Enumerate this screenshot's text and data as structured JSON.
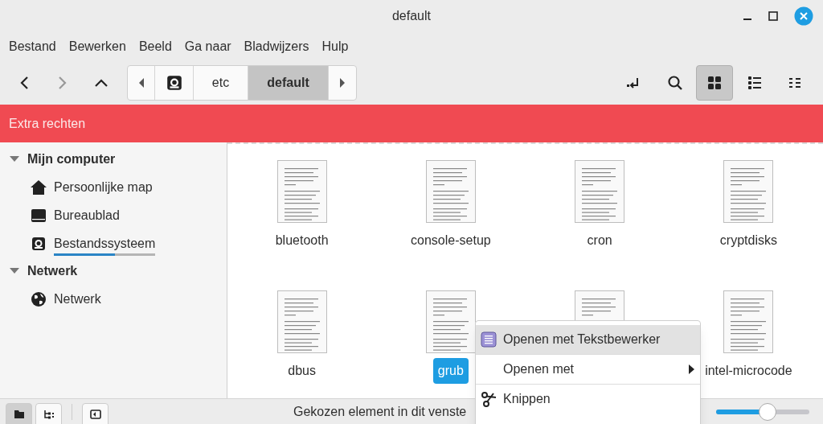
{
  "window": {
    "title": "default"
  },
  "menu": [
    "Bestand",
    "Bewerken",
    "Beeld",
    "Ga naar",
    "Bladwijzers",
    "Hulp"
  ],
  "nav": {
    "back_disabled": false,
    "forward_disabled": true
  },
  "breadcrumb": [
    {
      "kind": "drive",
      "selected": false
    },
    {
      "kind": "text",
      "label": "etc",
      "selected": false
    },
    {
      "kind": "text",
      "label": "default",
      "selected": true
    }
  ],
  "views": [
    {
      "kind": "grid",
      "selected": true
    },
    {
      "kind": "list",
      "selected": false
    },
    {
      "kind": "compact",
      "selected": false
    }
  ],
  "banner": "Extra rechten",
  "sidebar": [
    {
      "label": "Mijn computer",
      "expanded": true,
      "items": [
        {
          "kind": "home",
          "label": "Persoonlijke map"
        },
        {
          "kind": "desktop",
          "label": "Bureaublad"
        },
        {
          "kind": "drive",
          "label": "Bestandssysteem",
          "level": 0.6
        }
      ]
    },
    {
      "label": "Netwerk",
      "expanded": true,
      "items": [
        {
          "kind": "globe",
          "label": "Netwerk"
        }
      ]
    }
  ],
  "files": [
    {
      "name": "bluetooth",
      "selected": false
    },
    {
      "name": "console-setup",
      "selected": false
    },
    {
      "name": "cron",
      "selected": false
    },
    {
      "name": "cryptdisks",
      "selected": false
    },
    {
      "name": "dbus",
      "selected": false
    },
    {
      "name": "grub",
      "selected": true
    },
    {
      "name": "intel-microcode",
      "selected": false
    }
  ],
  "context_menu": [
    {
      "kind": "editor",
      "label": "Openen met Tekstbewerker",
      "selected": true
    },
    {
      "kind": "submenu",
      "label": "Openen met",
      "selected": false
    },
    {
      "kind": "cut",
      "label": "Knippen",
      "selected": false
    }
  ],
  "status_bar": {
    "panes": [
      {
        "kind": "places",
        "selected": true
      },
      {
        "kind": "tree",
        "selected": false
      }
    ],
    "text": "Gekozen element in dit venste",
    "zoom": {
      "level": 0.55
    }
  }
}
